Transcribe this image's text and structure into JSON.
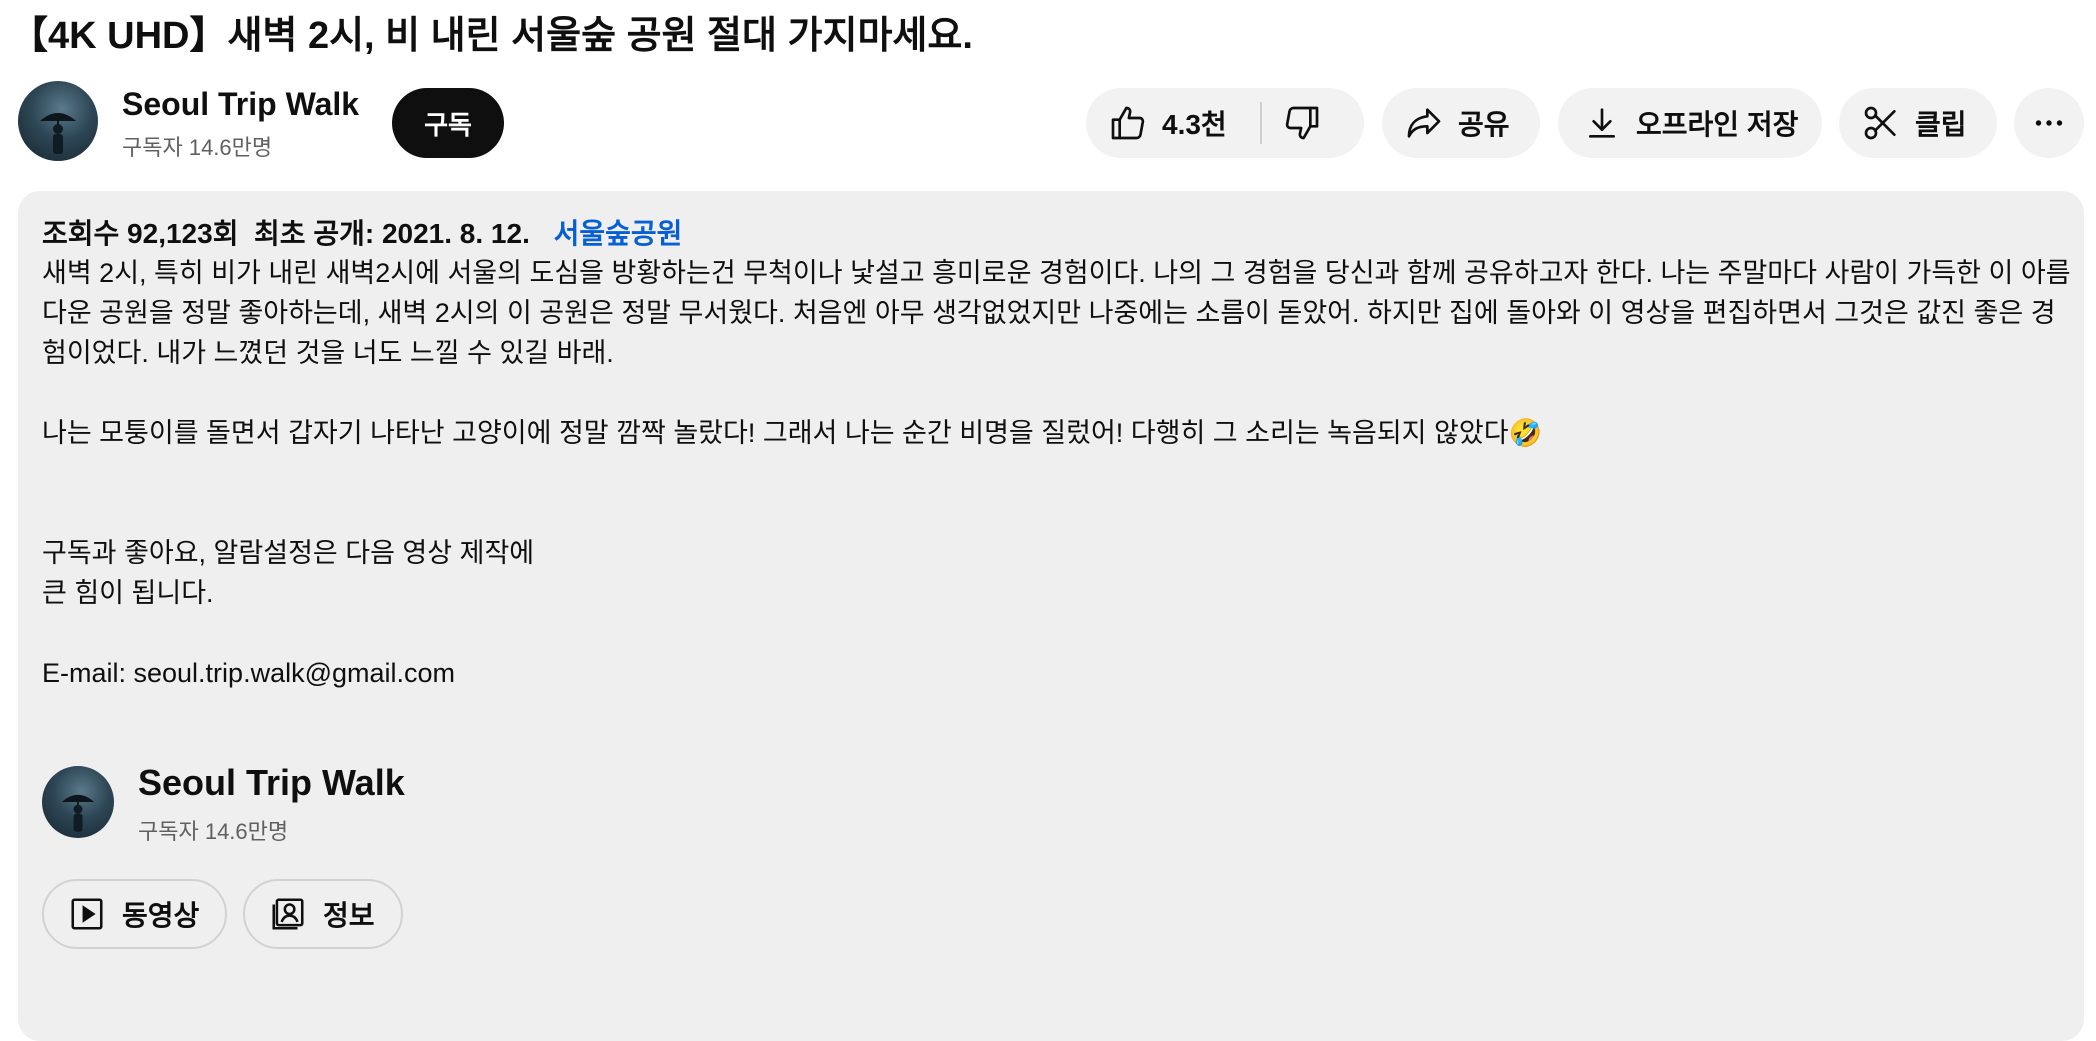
{
  "video": {
    "title": "【4K UHD】새벽 2시, 비 내린 서울숲 공원 절대 가지마세요."
  },
  "channel": {
    "name": "Seoul Trip Walk",
    "subscribers": "구독자 14.6만명",
    "subscribe_label": "구독"
  },
  "actions": {
    "like_count": "4.3천",
    "share_label": "공유",
    "download_label": "오프라인 저장",
    "clip_label": "클립"
  },
  "description": {
    "views": "조회수 92,123회",
    "published": "최초 공개: 2021. 8. 12.",
    "location_tag": "서울숲공원",
    "body": "새벽 2시, 특히 비가 내린 새벽2시에 서울의 도심을 방황하는건 무척이나 낯설고 흥미로운 경험이다. 나의 그 경험을 당신과 함께 공유하고자 한다. 나는 주말마다 사람이 가득한 이 아름다운 공원을 정말 좋아하는데, 새벽 2시의 이 공원은 정말 무서웠다. 처음엔 아무 생각없었지만 나중에는 소름이 돋았어. 하지만 집에 돌아와 이 영상을 편집하면서 그것은 값진 좋은 경험이었다. 내가 느꼈던 것을 너도 느낄 수 있길 바래.\n\n나는 모퉁이를 돌면서 갑자기 나타난 고양이에 정말 깜짝 놀랐다! 그래서 나는 순간 비명을 질렀어! 다행히 그 소리는 녹음되지 않았다🤣\n\n\n구독과 좋아요, 알람설정은 다음 영상 제작에\n큰 힘이 됩니다.\n\nE-mail: seoul.trip.walk@gmail.com"
  },
  "channel_card": {
    "name": "Seoul Trip Walk",
    "subscribers": "구독자 14.6만명",
    "videos_label": "동영상",
    "about_label": "정보"
  },
  "icons": {
    "like": "thumbs-up-icon",
    "dislike": "thumbs-down-icon",
    "share": "share-arrow-icon",
    "download": "download-icon",
    "clip": "scissors-icon",
    "more": "more-horizontal-icon",
    "videos": "play-square-icon",
    "about": "person-card-icon"
  },
  "colors": {
    "accent_link": "#065fd4",
    "subscribe_bg": "#0f0f0f",
    "pill_bg": "#f2f2f2",
    "description_bg": "#efefef"
  }
}
